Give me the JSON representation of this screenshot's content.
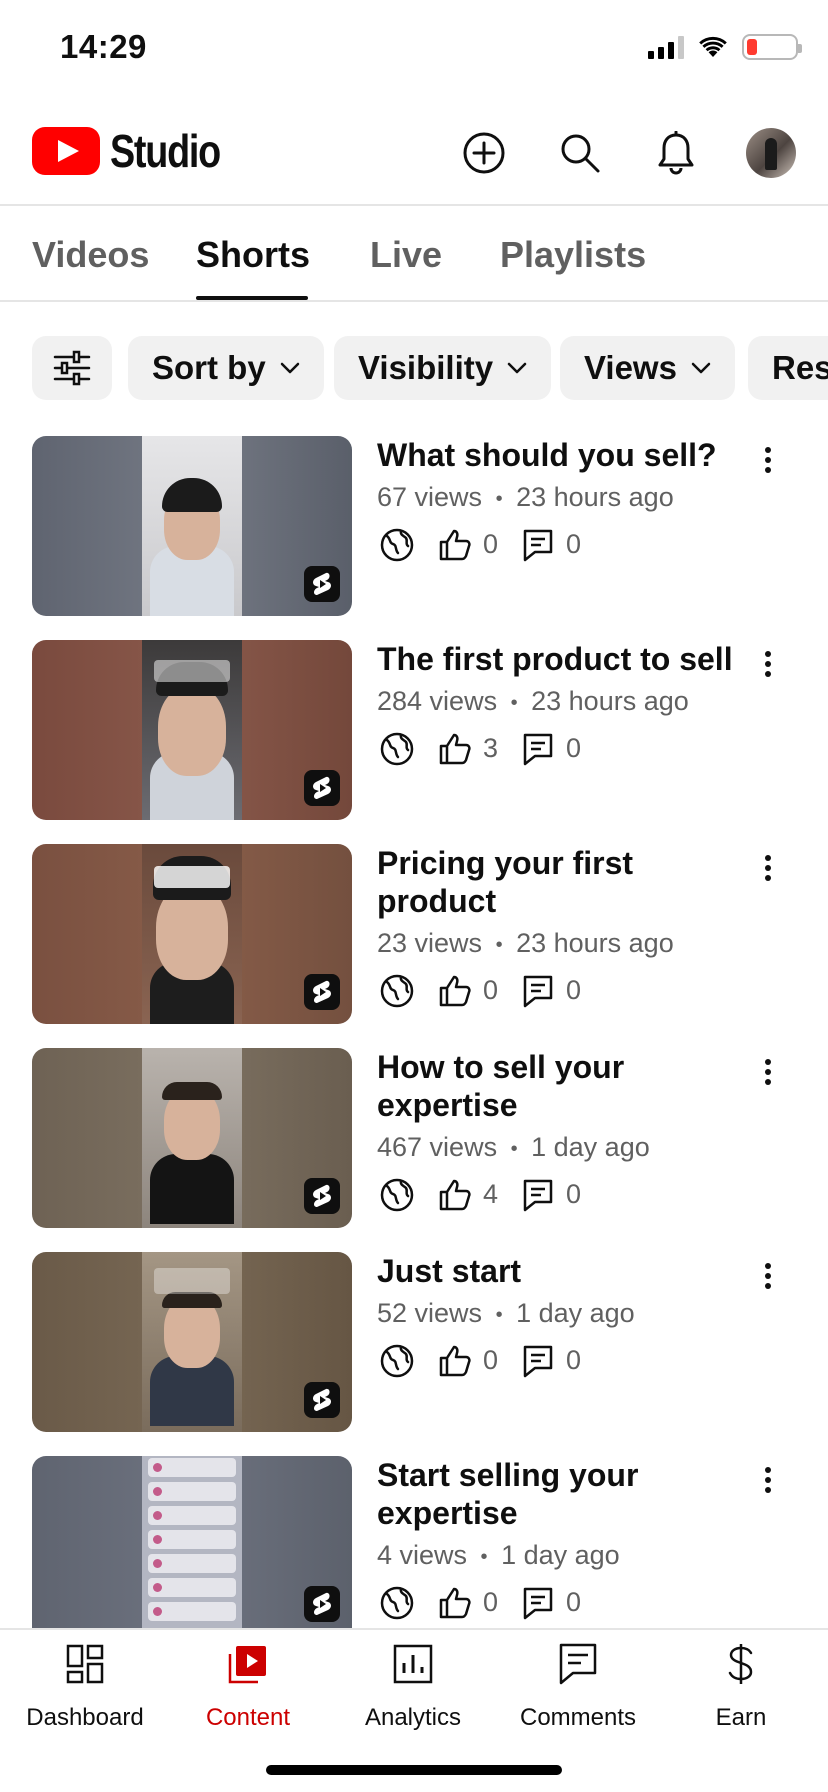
{
  "status_bar": {
    "time": "14:29",
    "battery_color": "#ff3b30"
  },
  "header": {
    "logo_text": "Studio",
    "brand_color": "#ff0000"
  },
  "tabs": [
    {
      "label": "Videos",
      "active": false
    },
    {
      "label": "Shorts",
      "active": true
    },
    {
      "label": "Live",
      "active": false
    },
    {
      "label": "Playlists",
      "active": false
    }
  ],
  "filters": {
    "icon": "sliders-icon",
    "chips": [
      {
        "label": "Sort by"
      },
      {
        "label": "Visibility"
      },
      {
        "label": "Views"
      },
      {
        "label": "Res"
      }
    ]
  },
  "videos": [
    {
      "title": "What should you sell?",
      "views": "67 views",
      "age": "23 hours ago",
      "likes": "0",
      "comments": "0"
    },
    {
      "title": "The first product to sell",
      "views": "284 views",
      "age": "23 hours ago",
      "likes": "3",
      "comments": "0"
    },
    {
      "title": "Pricing your first product",
      "views": "23 views",
      "age": "23 hours ago",
      "likes": "0",
      "comments": "0"
    },
    {
      "title": "How to sell your expertise",
      "views": "467 views",
      "age": "1 day ago",
      "likes": "4",
      "comments": "0"
    },
    {
      "title": "Just start",
      "views": "52 views",
      "age": "1 day ago",
      "likes": "0",
      "comments": "0"
    },
    {
      "title": "Start selling your expertise",
      "views": "4 views",
      "age": "1 day ago",
      "likes": "0",
      "comments": "0"
    }
  ],
  "meta_separator": "•",
  "bottom_nav": [
    {
      "label": "Dashboard",
      "icon": "dashboard-icon",
      "active": false
    },
    {
      "label": "Content",
      "icon": "content-icon",
      "active": true
    },
    {
      "label": "Analytics",
      "icon": "analytics-icon",
      "active": false
    },
    {
      "label": "Comments",
      "icon": "comments-icon",
      "active": false
    },
    {
      "label": "Earn",
      "icon": "dollar-icon",
      "active": false
    }
  ],
  "colors": {
    "accent": "#cc0000",
    "text_secondary": "#606060",
    "chip_bg": "#f1f1f1"
  }
}
